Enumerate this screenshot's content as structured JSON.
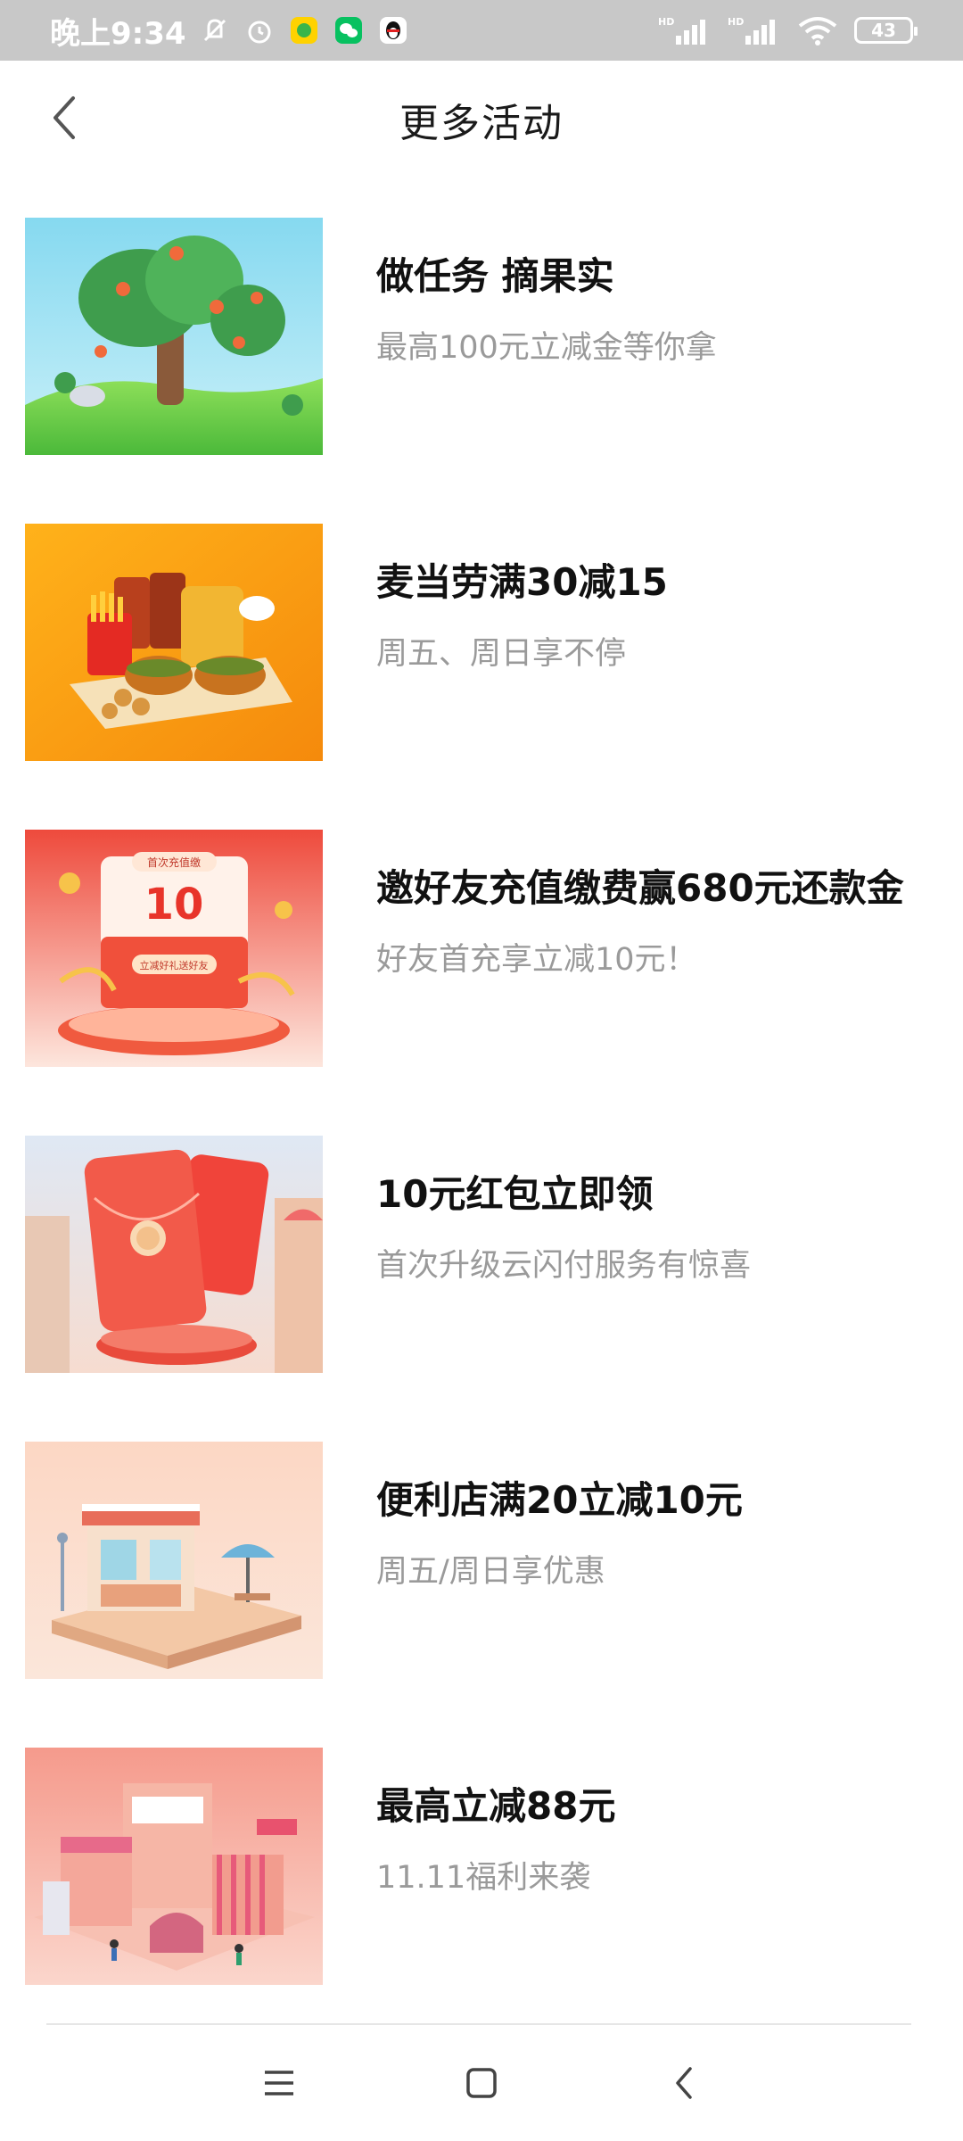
{
  "status_bar": {
    "time": "晚上9:34",
    "battery": "43",
    "icons": [
      "mute-icon",
      "alarm-icon",
      "app-icon",
      "wechat-icon",
      "qq-icon",
      "hd-signal-icon",
      "hd-signal-icon",
      "wifi-icon",
      "battery-icon"
    ]
  },
  "header": {
    "title": "更多活动",
    "back_icon": "chevron-left-icon"
  },
  "activities": [
    {
      "title": "做任务 摘果实",
      "subtitle": "最高100元立减金等你拿"
    },
    {
      "title": "麦当劳满30减15",
      "subtitle": "周五、周日享不停"
    },
    {
      "title": "邀好友充值缴费赢680元还款金",
      "subtitle": "好友首充享立减10元！"
    },
    {
      "title": "10元红包立即领",
      "subtitle": "首次升级云闪付服务有惊喜"
    },
    {
      "title": "便利店满20立减10元",
      "subtitle": "周五/周日享优惠"
    },
    {
      "title": "最高立减88元",
      "subtitle": "11.11福利来袭"
    }
  ],
  "thumb_texts": {
    "invite_banner": "首次充值缴",
    "invite_amount": "10",
    "invite_button": "立减好礼送好友"
  },
  "nav": {
    "icons": [
      "menu-icon",
      "home-square-icon",
      "back-icon"
    ]
  },
  "colors": {
    "status_bar_bg": "#c8c8c8",
    "title_text": "#111111",
    "subtitle_text": "#9a9a9a"
  }
}
